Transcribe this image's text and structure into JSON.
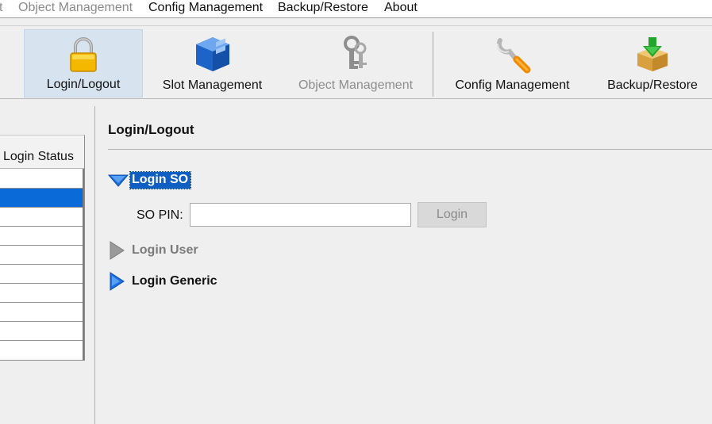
{
  "menubar": {
    "items": [
      {
        "label": "t",
        "state": "disabled"
      },
      {
        "label": "Object Management",
        "state": "disabled"
      },
      {
        "label": "Config Management",
        "state": "enabled"
      },
      {
        "label": "Backup/Restore",
        "state": "enabled"
      },
      {
        "label": "About",
        "state": "enabled"
      }
    ]
  },
  "toolbar": {
    "buttons": [
      {
        "label": "Login/Logout",
        "icon": "padlock-icon",
        "state": "selected"
      },
      {
        "label": "Slot Management",
        "icon": "cabinet-icon",
        "state": "enabled"
      },
      {
        "label": "Object Management",
        "icon": "keys-icon",
        "state": "disabled"
      },
      {
        "label": "Config Management",
        "icon": "wrench-icon",
        "state": "enabled"
      },
      {
        "label": "Backup/Restore",
        "icon": "box-download-icon",
        "state": "enabled"
      }
    ]
  },
  "slot_table": {
    "column_header": "Login Status",
    "selected_row_index": 1,
    "row_count": 9
  },
  "content": {
    "title": "Login/Logout",
    "sections": [
      {
        "label": "Login SO",
        "expanded": true,
        "state": "active"
      },
      {
        "label": "Login User",
        "expanded": false,
        "state": "disabled"
      },
      {
        "label": "Login Generic",
        "expanded": false,
        "state": "enabled"
      }
    ],
    "so_pin_label": "SO PIN:",
    "so_pin_value": "",
    "login_button_label": "Login"
  },
  "colors": {
    "selection": "#0a6ad8",
    "active_section": "#0f5fc3",
    "toolbar_selected": "#d7e3ef"
  }
}
